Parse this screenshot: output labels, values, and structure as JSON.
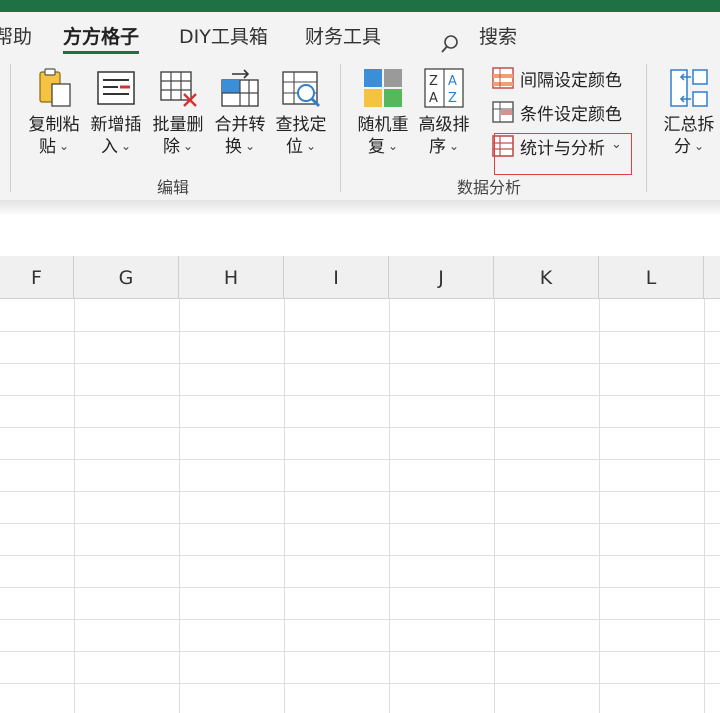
{
  "tabs": [
    {
      "label": "帮助",
      "active": false
    },
    {
      "label": "方方格子",
      "active": true
    },
    {
      "label": "DIY工具箱",
      "active": false
    },
    {
      "label": "财务工具",
      "active": false
    }
  ],
  "search": {
    "label": "搜索"
  },
  "ribbon": {
    "edit_group": {
      "label": "编辑",
      "buttons": [
        {
          "line1": "复制粘",
          "line2": "贴"
        },
        {
          "line1": "新增插",
          "line2": "入"
        },
        {
          "line1": "批量删",
          "line2": "除"
        },
        {
          "line1": "合并转",
          "line2": "换"
        },
        {
          "line1": "查找定",
          "line2": "位"
        }
      ]
    },
    "data_group": {
      "label": "数据分析",
      "buttons": [
        {
          "line1": "随机重",
          "line2": "复"
        },
        {
          "line1": "高级排",
          "line2": "序"
        }
      ],
      "small_buttons": [
        {
          "label": "间隔设定颜色"
        },
        {
          "label": "条件设定颜色"
        },
        {
          "label": "统计与分析"
        }
      ]
    },
    "summary_button": {
      "line1": "汇总拆",
      "line2": "分"
    }
  },
  "columns": [
    "F",
    "G",
    "H",
    "I",
    "J",
    "K",
    "L"
  ],
  "colors": {
    "accent": "#1e7145",
    "highlight": "#e04040"
  }
}
